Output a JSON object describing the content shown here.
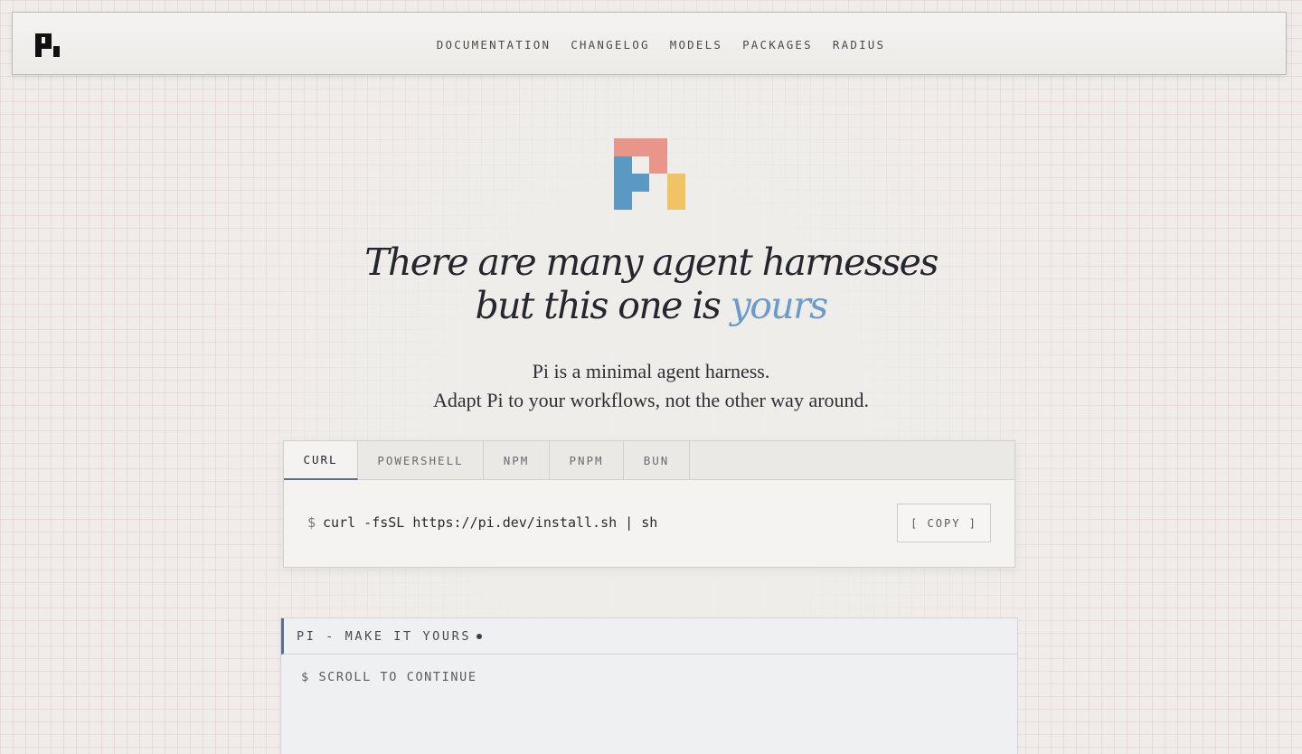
{
  "header": {
    "logo_icon": "pi-logo-icon",
    "nav": [
      {
        "label": "DOCUMENTATION"
      },
      {
        "label": "CHANGELOG"
      },
      {
        "label": "MODELS"
      },
      {
        "label": "PACKAGES"
      },
      {
        "label": "RADIUS"
      }
    ]
  },
  "hero": {
    "logo_icon": "pi-color-logo-icon",
    "logo_colors": {
      "top": "#e9958a",
      "left": "#5b98c2",
      "right": "#f0c464"
    },
    "headline_line1": "There are many agent harnesses",
    "headline_line2_prefix": "but this one is",
    "headline_accent": "yours",
    "accent_color": "#6b9bc8",
    "subline1": "Pi is a minimal agent harness.",
    "subline2": "Adapt Pi to your workflows, not the other way around."
  },
  "install": {
    "tabs": [
      {
        "label": "CURL",
        "active": true
      },
      {
        "label": "POWERSHELL",
        "active": false
      },
      {
        "label": "NPM",
        "active": false
      },
      {
        "label": "PNPM",
        "active": false
      },
      {
        "label": "BUN",
        "active": false
      }
    ],
    "prompt": "$",
    "command": "curl -fsSL https://pi.dev/install.sh | sh",
    "copy_label": "[ COPY ]"
  },
  "terminal": {
    "title": "PI - MAKE IT YOURS",
    "line": "$ SCROLL TO CONTINUE"
  }
}
